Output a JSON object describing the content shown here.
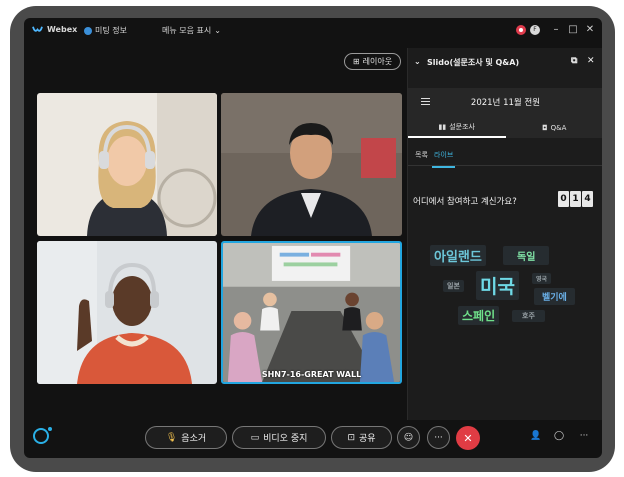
{
  "titlebar": {
    "app_name": "Webex",
    "meeting_info": "미팅 정보",
    "menu_toggle": "메뉴 모음 표시",
    "participant_initial": "F"
  },
  "stage": {
    "layout_button": "레이아웃",
    "room_label": "SHN7-16-GREAT WALL"
  },
  "slido": {
    "panel_title": "Slido(설문조사 및 Q&A)",
    "event_title": "2021년 11월 전원",
    "tabs": [
      {
        "label": "설문조사",
        "icon": "bar-chart-icon"
      },
      {
        "label": "Q&A",
        "icon": "speech-bubble-icon"
      }
    ],
    "sub_tabs": [
      "목록",
      "라이브"
    ],
    "question": "어디에서 참여하고 계신가요?",
    "counter_digits": [
      "0",
      "1",
      "4"
    ],
    "word_cloud": [
      {
        "text": "아일랜드",
        "color": "#6cc6d8"
      },
      {
        "text": "독일",
        "color": "#7fe0a4"
      },
      {
        "text": "일본",
        "color": "#9aa3a8"
      },
      {
        "text": "미국",
        "color": "#6fd9e6"
      },
      {
        "text": "영국",
        "color": "#9aa3a8"
      },
      {
        "text": "벨기에",
        "color": "#6ab0e8"
      },
      {
        "text": "스페인",
        "color": "#6fe08a"
      },
      {
        "text": "호주",
        "color": "#9aa3a8"
      }
    ]
  },
  "controls": {
    "mute_label": "음소거",
    "video_label": "비디오 중지",
    "share_label": "공유",
    "more_label": "···"
  },
  "colors": {
    "accent": "#22a6e0",
    "end_call": "#e03c44",
    "recording": "#e03c4d"
  }
}
